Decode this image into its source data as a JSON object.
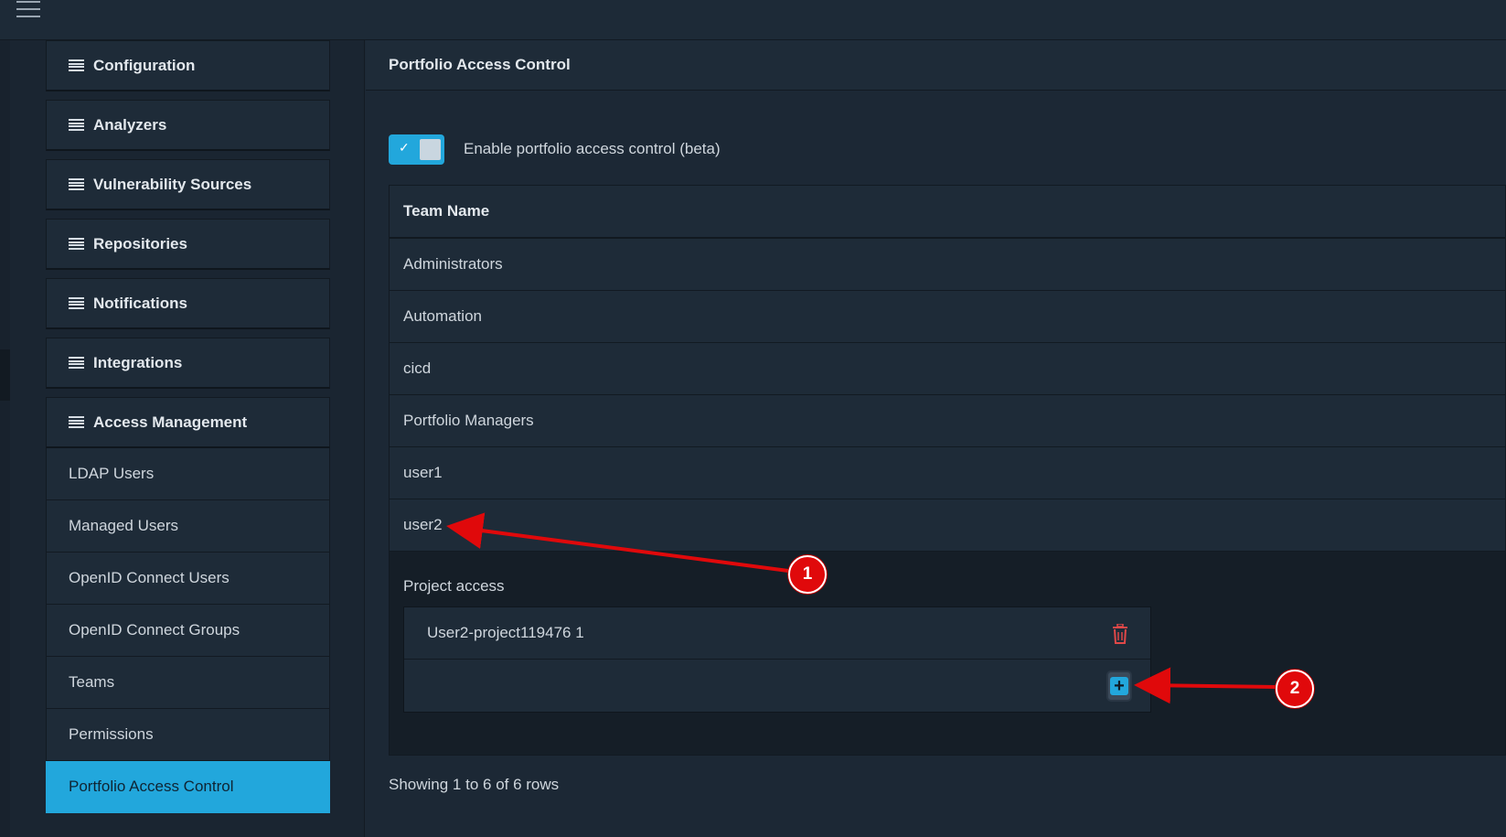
{
  "topbar": {
    "menu_icon": "hamburger-menu-icon"
  },
  "sidebar": {
    "sections": [
      {
        "label": "Configuration"
      },
      {
        "label": "Analyzers"
      },
      {
        "label": "Vulnerability Sources"
      },
      {
        "label": "Repositories"
      },
      {
        "label": "Notifications"
      },
      {
        "label": "Integrations"
      },
      {
        "label": "Access Management"
      }
    ],
    "access_items": [
      {
        "label": "LDAP Users"
      },
      {
        "label": "Managed Users"
      },
      {
        "label": "OpenID Connect Users"
      },
      {
        "label": "OpenID Connect Groups"
      },
      {
        "label": "Teams"
      },
      {
        "label": "Permissions"
      },
      {
        "label": "Portfolio Access Control",
        "active": true
      }
    ]
  },
  "main": {
    "title": "Portfolio Access Control",
    "toggle": {
      "label": "Enable portfolio access control (beta)",
      "checked": true
    },
    "table": {
      "header": "Team Name",
      "rows": [
        "Administrators",
        "Automation",
        "cicd",
        "Portfolio Managers",
        "user1",
        "user2"
      ],
      "expanded": {
        "label": "Project access",
        "projects": [
          "User2-project119476 1"
        ]
      }
    },
    "footer": "Showing 1 to 6 of 6 rows"
  },
  "annotations": {
    "badge1": "1",
    "badge2": "2"
  },
  "colors": {
    "accent": "#22a7dc",
    "annotation": "#e0090b",
    "delete": "#e04848"
  }
}
